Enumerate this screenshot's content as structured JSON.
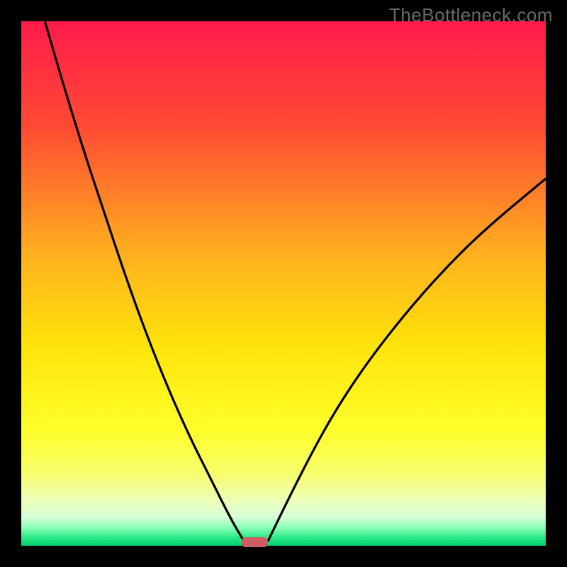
{
  "watermark": "TheBottleneck.com",
  "chart_data": {
    "type": "line",
    "title": "",
    "xlabel": "",
    "ylabel": "",
    "xlim": [
      0,
      100
    ],
    "ylim": [
      0,
      100
    ],
    "note": "Two curves plunging toward a minimum near x≈44; gradient background red→yellow→green; small red/pink rounded marker at the minimum on the x-axis.",
    "series": [
      {
        "name": "left-curve",
        "x": [
          4.5,
          8,
          12,
          16,
          20,
          24,
          28,
          32,
          36,
          40,
          42.5
        ],
        "y": [
          100,
          88,
          75,
          63,
          51,
          40,
          30,
          21,
          13,
          5,
          0.8
        ]
      },
      {
        "name": "right-curve",
        "x": [
          47,
          50,
          55,
          60,
          66,
          73,
          80,
          88,
          100
        ],
        "y": [
          0.8,
          7,
          17,
          26,
          35,
          44,
          52,
          60,
          70
        ]
      }
    ],
    "minimum_marker": {
      "x": 44.5,
      "width": 5,
      "color": "#cf5d5f"
    },
    "gradient_stops": [
      {
        "offset": 0.0,
        "color": "#ff1b4b"
      },
      {
        "offset": 0.2,
        "color": "#ff4a33"
      },
      {
        "offset": 0.45,
        "color": "#ffb21e"
      },
      {
        "offset": 0.62,
        "color": "#ffe40a"
      },
      {
        "offset": 0.78,
        "color": "#ffff2a"
      },
      {
        "offset": 0.86,
        "color": "#f7ff6a"
      },
      {
        "offset": 0.91,
        "color": "#eeffb5"
      },
      {
        "offset": 0.945,
        "color": "#d8ffd8"
      },
      {
        "offset": 0.965,
        "color": "#8cffb8"
      },
      {
        "offset": 0.985,
        "color": "#27e884"
      },
      {
        "offset": 1.0,
        "color": "#00d173"
      }
    ]
  }
}
